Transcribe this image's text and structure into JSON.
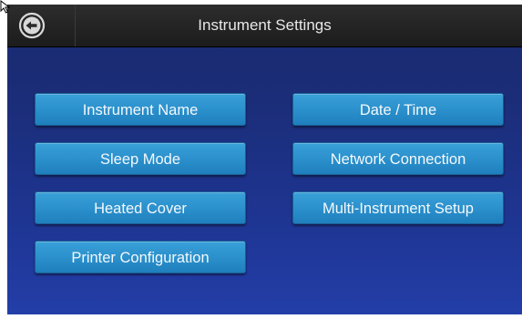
{
  "header": {
    "title": "Instrument Settings",
    "back_icon": "back-arrow-icon"
  },
  "buttons": {
    "instrument_name": "Instrument Name",
    "date_time": "Date / Time",
    "sleep_mode": "Sleep Mode",
    "network_connection": "Network Connection",
    "heated_cover": "Heated Cover",
    "multi_instrument_setup": "Multi-Instrument Setup",
    "printer_configuration": "Printer Configuration"
  },
  "colors": {
    "background": "#1e3592",
    "button": "#2a8fcb",
    "titlebar": "#1f1f1f"
  }
}
